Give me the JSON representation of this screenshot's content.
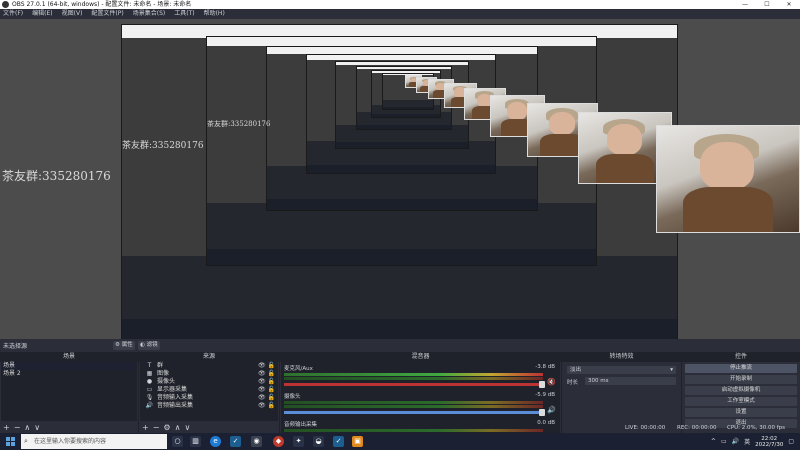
{
  "window": {
    "title": "OBS 27.0.1 (64-bit, windows) - 配置文件: 未命名 - 场景: 未命名",
    "controls": [
      "—",
      "☐",
      "✕"
    ]
  },
  "menu": [
    "文件(F)",
    "编辑(E)",
    "视图(V)",
    "配置文件(P)",
    "场景集合(S)",
    "工具(T)",
    "帮助(H)"
  ],
  "watermarks": [
    "茶友群:335280176",
    "茶友群:335280176",
    "茶友群:335280176"
  ],
  "status_strip": {
    "no_source": "未选择源",
    "properties": "属性",
    "filters": "滤镜"
  },
  "scenes": {
    "title": "场景",
    "items": [
      "场景",
      "场景 2"
    ],
    "footer": [
      "+",
      "−",
      "∧",
      "∨"
    ]
  },
  "sources": {
    "title": "来源",
    "items": [
      {
        "icon": "T",
        "name": "群"
      },
      {
        "icon": "▦",
        "name": "图像"
      },
      {
        "icon": "●",
        "name": "摄像头"
      },
      {
        "icon": "▭",
        "name": "显示器采集"
      },
      {
        "icon": "🎙",
        "name": "音频输入采集"
      },
      {
        "icon": "🔊",
        "name": "音频输出采集"
      }
    ],
    "footer": [
      "+",
      "−",
      "⚙",
      "∧",
      "∨"
    ]
  },
  "mixer": {
    "title": "混音器",
    "channels": [
      {
        "name": "麦克风/Aux",
        "db": "-3.8 dB"
      },
      {
        "name": "摄像头",
        "db": "-5.9 dB"
      },
      {
        "name": "音频输出采集",
        "db": "0.0 dB"
      }
    ]
  },
  "transitions": {
    "title": "转场特效",
    "type": "淡出",
    "duration_label": "时长",
    "duration": "300 ms"
  },
  "controls": {
    "title": "控件",
    "buttons": [
      "停止推流",
      "开始录制",
      "启动虚拟摄像机",
      "工作室模式",
      "设置",
      "退出"
    ]
  },
  "statusbar": {
    "live": "LIVE: 00:00:00",
    "rec": "REC: 00:00:00",
    "cpu": "CPU: 2.0%, 30.00 fps"
  },
  "taskbar": {
    "search_placeholder": "在这里输入你要搜索的内容",
    "time": "22:02",
    "date": "2022/7/30"
  }
}
